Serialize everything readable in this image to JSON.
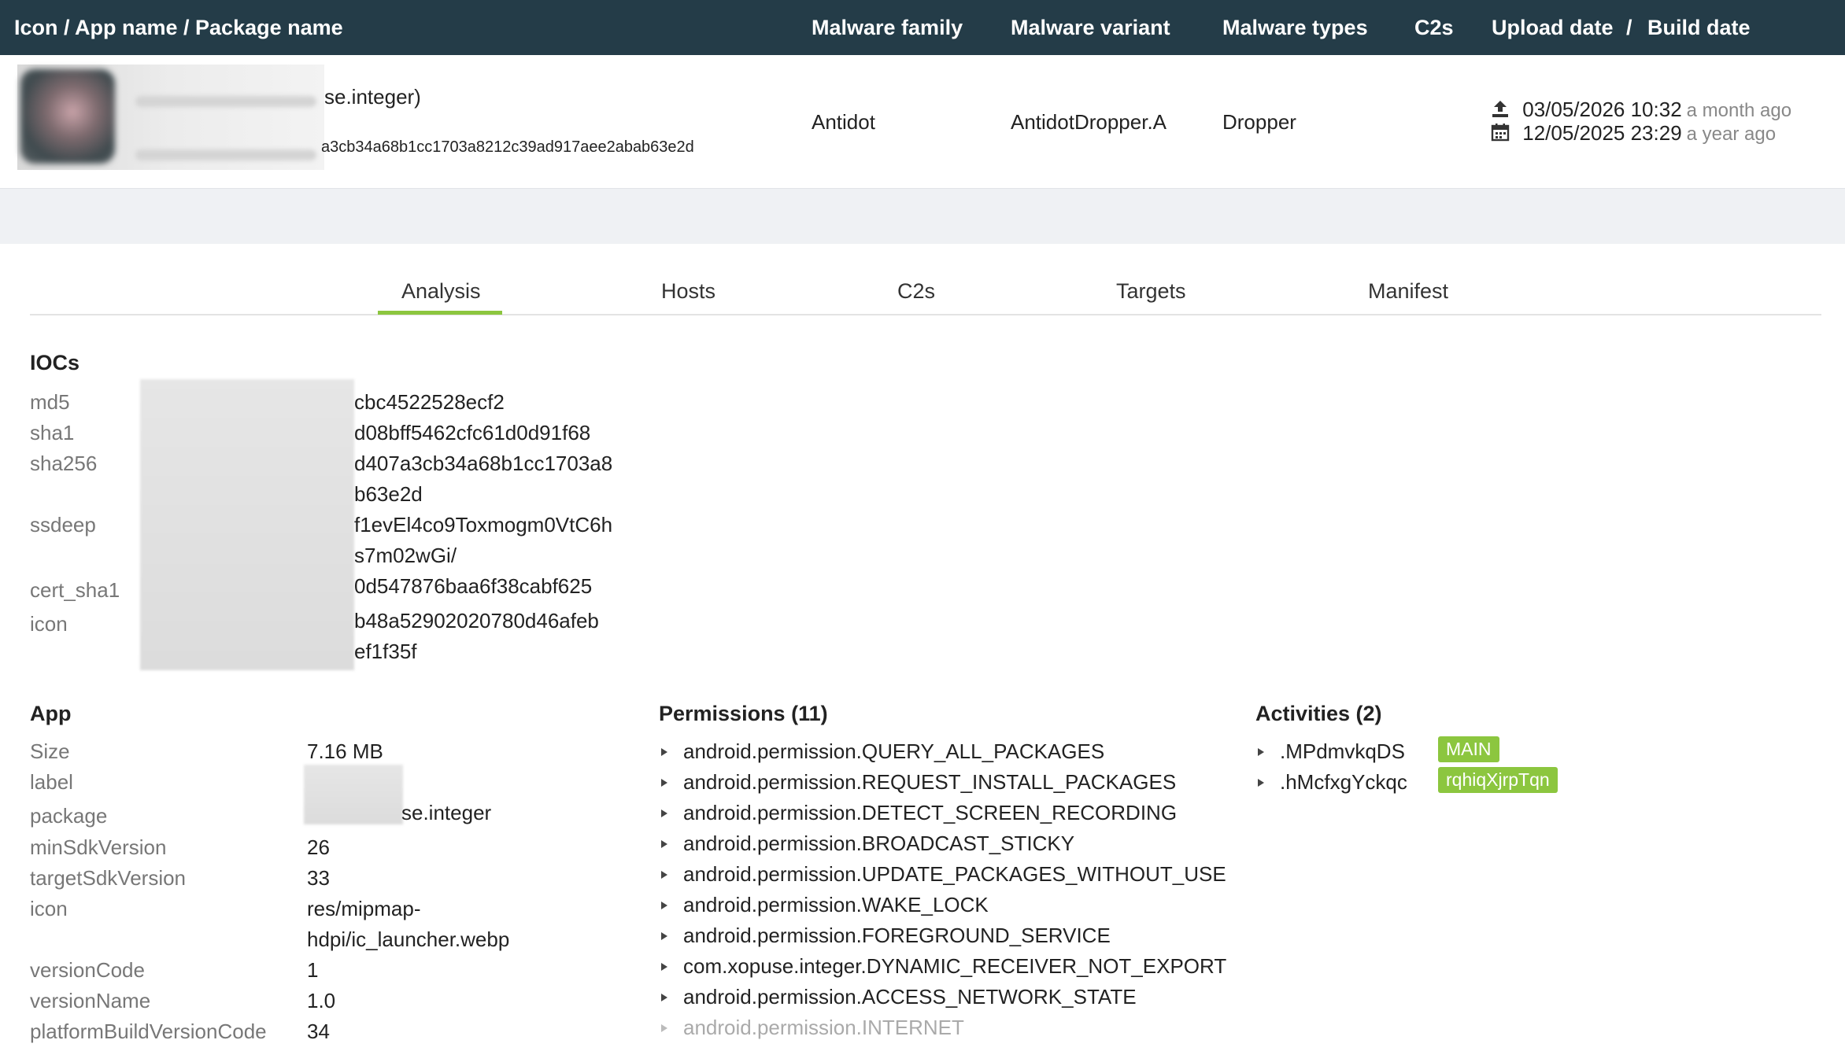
{
  "header": {
    "col_icon": "Icon / App name / Package name",
    "col_family": "Malware family",
    "col_variant": "Malware variant",
    "col_types": "Malware types",
    "col_c2s": "C2s",
    "col_upload": "Upload date",
    "col_sep": "/",
    "col_build": "Build date"
  },
  "sample": {
    "app_name_partial": "se.integer)",
    "hash_partial": "a3cb34a68b1cc1703a8212c39ad917aee2abab63e2d",
    "family": "Antidot",
    "variant": "AntidotDropper.A",
    "types": "Dropper",
    "upload_date": "03/05/2026 10:32",
    "upload_ago": "a month ago",
    "build_date": "12/05/2025 23:29",
    "build_ago": "a year ago"
  },
  "tabs": [
    "Analysis",
    "Hosts",
    "C2s",
    "Targets",
    "Manifest"
  ],
  "iocs": {
    "title": "IOCs",
    "keys": [
      "md5",
      "sha1",
      "sha256",
      "ssdeep",
      "cert_sha1",
      "icon"
    ],
    "values": [
      "cbc4522528ecf2",
      "d08bff5462cfc61d0d91f68",
      "d407a3cb34a68b1cc1703a8",
      "b63e2d",
      "f1evEl4co9Toxmogm0VtC6h",
      "s7m02wGi/",
      "0d547876baa6f38cabf625",
      "b48a52902020780d46afeb",
      "ef1f35f"
    ]
  },
  "app": {
    "title": "App",
    "keys": [
      "Size",
      "label",
      "package",
      "minSdkVersion",
      "targetSdkVersion",
      "icon",
      "versionCode",
      "versionName",
      "platformBuildVersionCode"
    ],
    "size": "7.16 MB",
    "package": "se.integer",
    "minSdk": "26",
    "targetSdk": "33",
    "icon1": "res/mipmap-",
    "icon2": "hdpi/ic_launcher.webp",
    "versionCode": "1",
    "versionName": "1.0",
    "platformBuild": "34"
  },
  "permissions": {
    "title": "Permissions (11)",
    "items": [
      "android.permission.QUERY_ALL_PACKAGES",
      "android.permission.REQUEST_INSTALL_PACKAGES",
      "android.permission.DETECT_SCREEN_RECORDING",
      "android.permission.BROADCAST_STICKY",
      "android.permission.UPDATE_PACKAGES_WITHOUT_USE",
      "android.permission.WAKE_LOCK",
      "android.permission.FOREGROUND_SERVICE",
      "com.xopuse.integer.DYNAMIC_RECEIVER_NOT_EXPORT",
      "android.permission.ACCESS_NETWORK_STATE",
      "android.permission.INTERNET"
    ]
  },
  "activities": {
    "title": "Activities (2)",
    "items": [
      ".MPdmvkqDS",
      ".hMcfxgYckqc"
    ],
    "badges": [
      "MAIN",
      "rqhiqXjrpTqn"
    ]
  },
  "colors": {
    "header_bg": "#243c48",
    "accent": "#8cc63f",
    "band": "#eff1f4"
  },
  "icons": [
    "upload-icon",
    "calendar-icon",
    "disclosure-arrow-icon"
  ]
}
